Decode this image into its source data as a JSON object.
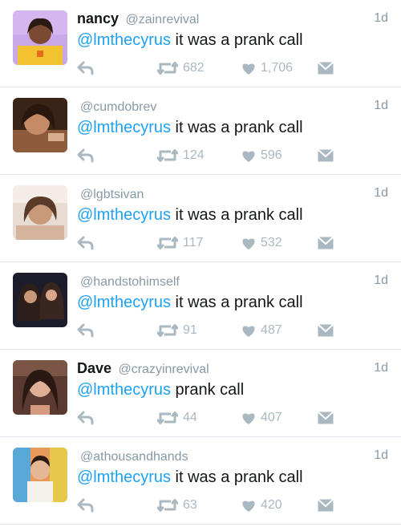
{
  "tweets": [
    {
      "name": "nancy",
      "handle": "@zainrevival",
      "time": "1d",
      "mention": "@lmthecyrus",
      "text": " it was a prank call",
      "retweets": "682",
      "likes": "1,706"
    },
    {
      "name": "",
      "handle": "@cumdobrev",
      "time": "1d",
      "mention": "@lmthecyrus",
      "text": " it was a prank call",
      "retweets": "124",
      "likes": "596"
    },
    {
      "name": "",
      "handle": "@lgbtsivan",
      "time": "1d",
      "mention": "@lmthecyrus",
      "text": " it was a prank call",
      "retweets": "117",
      "likes": "532"
    },
    {
      "name": "",
      "handle": "@handstohimself",
      "time": "1d",
      "mention": "@lmthecyrus",
      "text": " it was a prank call",
      "retweets": "91",
      "likes": "487"
    },
    {
      "name": "Dave",
      "handle": "@crazyinrevival",
      "time": "1d",
      "mention": "@lmthecyrus",
      "text": " prank call",
      "retweets": "44",
      "likes": "407"
    },
    {
      "name": "",
      "handle": "@athousandhands",
      "time": "1d",
      "mention": "@lmthecyrus",
      "text": " it was a prank call",
      "retweets": "63",
      "likes": "420"
    }
  ],
  "colors": {
    "mention": "#1da1f2",
    "meta": "#8899a6",
    "action": "#aab8c2",
    "text": "#14171a",
    "divider": "#e1e8ed"
  },
  "icons": [
    "reply-icon",
    "retweet-icon",
    "like-icon",
    "direct-message-icon"
  ]
}
